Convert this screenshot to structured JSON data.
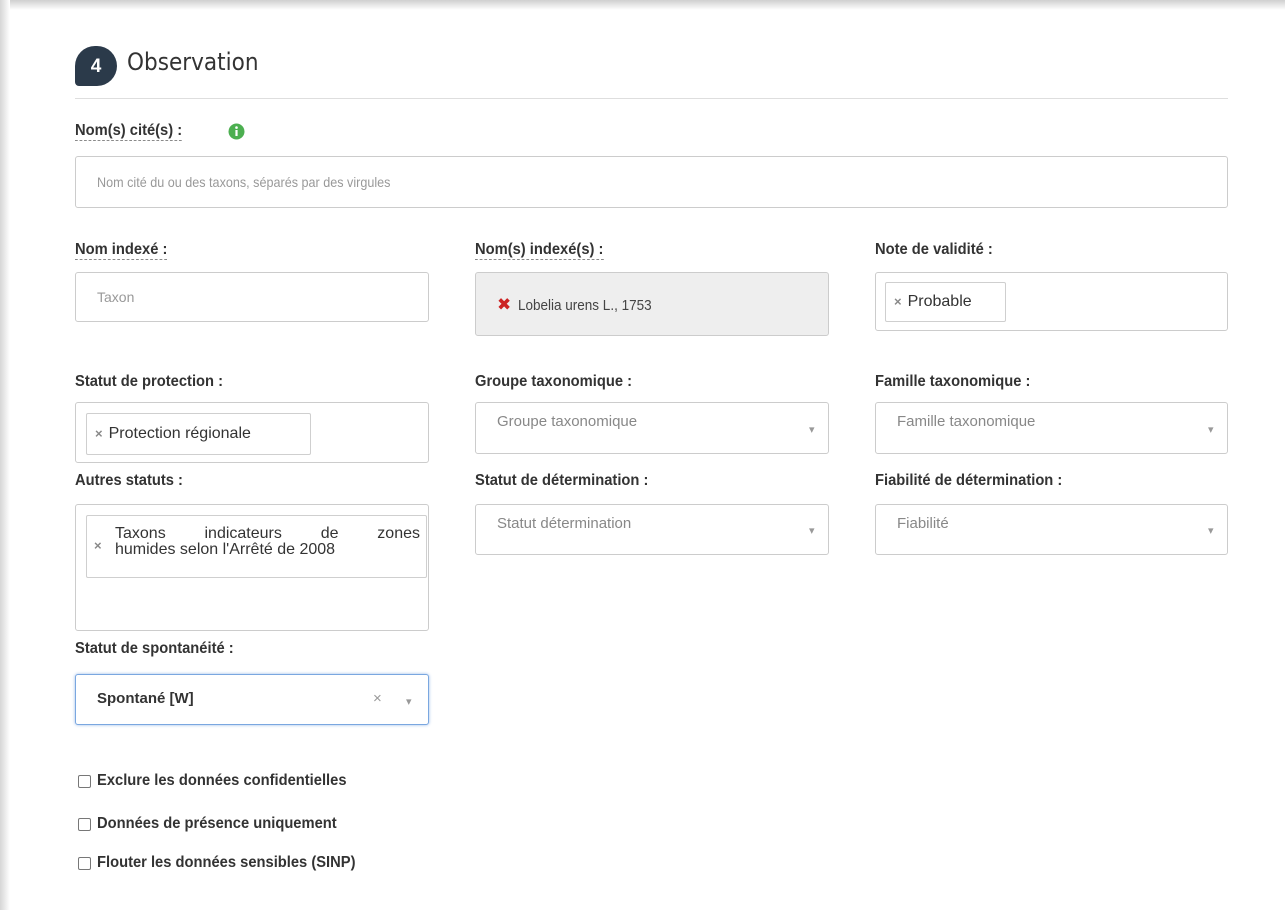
{
  "section": {
    "step": "4",
    "title": "Observation"
  },
  "nom_cites": {
    "label": "Nom(s) cité(s) :",
    "placeholder": "Nom cité du ou des taxons, séparés par des virgules",
    "info_icon": "info-circle-icon",
    "info_color": "#4caf50"
  },
  "nom_indexe": {
    "label": "Nom indexé :",
    "placeholder": "Taxon"
  },
  "noms_indexes": {
    "label": "Nom(s) indexé(s) :",
    "value": "Lobelia urens L., 1753",
    "remove_icon": "red-cross-icon",
    "remove_color": "#cc2222"
  },
  "note_validite": {
    "label": "Note de validité :",
    "tag": "Probable"
  },
  "statut_protection": {
    "label": "Statut de protection :",
    "tag": "Protection régionale"
  },
  "groupe_taxo": {
    "label": "Groupe taxonomique :",
    "placeholder": "Groupe taxonomique"
  },
  "famille_taxo": {
    "label": "Famille taxonomique :",
    "placeholder": "Famille taxonomique"
  },
  "autres_statuts": {
    "label": "Autres statuts :",
    "tag_line1": "Taxons indicateurs de zones",
    "tag_line2": "humides selon l'Arrêté de 2008"
  },
  "statut_determination": {
    "label": "Statut de détermination :",
    "placeholder": "Statut détermination"
  },
  "fiabilite": {
    "label": "Fiabilité de détermination :",
    "placeholder": "Fiabilité"
  },
  "spontaneite": {
    "label": "Statut de spontanéité :",
    "value": "Spontané [W]",
    "focus_color": "#7aa7e0"
  },
  "checkboxes": [
    {
      "label": "Exclure les données confidentielles",
      "checked": false
    },
    {
      "label": "Données de présence uniquement",
      "checked": false
    },
    {
      "label": "Flouter les données sensibles (SINP)",
      "checked": false
    }
  ],
  "glyphs": {
    "tag_remove": "×",
    "clear": "×",
    "caret": "▾",
    "red_cross": "✖"
  },
  "colors": {
    "badge_bg": "#2b3a4a",
    "border": "#cccccc",
    "disabled_bg": "#eeeeee"
  }
}
